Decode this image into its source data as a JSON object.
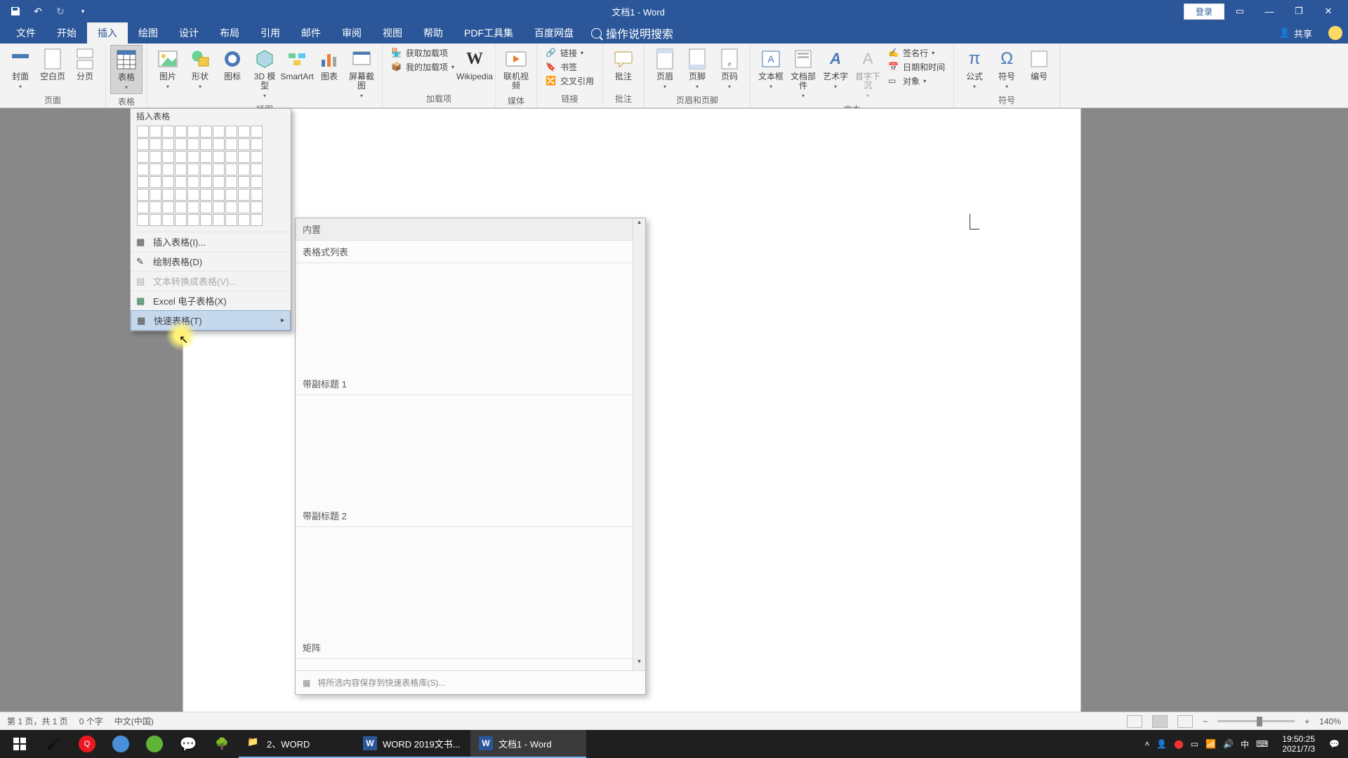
{
  "titlebar": {
    "title": "文档1 - Word",
    "login": "登录"
  },
  "tabs": {
    "file": "文件",
    "home": "开始",
    "insert": "插入",
    "draw": "绘图",
    "design": "设计",
    "layout": "布局",
    "references": "引用",
    "mailings": "邮件",
    "review": "审阅",
    "view": "视图",
    "help": "帮助",
    "pdf": "PDF工具集",
    "baidu": "百度网盘",
    "tellme": "操作说明搜索",
    "share": "共享"
  },
  "ribbon": {
    "groups": {
      "pages": "页面",
      "tables": "表格",
      "illustrations": "插图",
      "addins": "加载项",
      "media": "媒体",
      "links": "链接",
      "comments": "批注",
      "headerfooter": "页眉和页脚",
      "text": "文本",
      "symbols": "符号"
    },
    "buttons": {
      "cover": "封面",
      "blank": "空白页",
      "break": "分页",
      "table": "表格",
      "picture": "图片",
      "shapes": "形状",
      "icons": "图标",
      "model3d": "3D 模型",
      "smartart": "SmartArt",
      "chart": "图表",
      "screenshot": "屏幕截图",
      "getaddins": "获取加载项",
      "myaddins": "我的加载项",
      "wikipedia": "Wikipedia",
      "onlinevideo": "联机视频",
      "link": "链接",
      "bookmark": "书签",
      "crossref": "交叉引用",
      "comment": "批注",
      "header": "页眉",
      "footer": "页脚",
      "pagenum": "页码",
      "textbox": "文本框",
      "quickparts": "文档部件",
      "wordart": "艺术字",
      "dropcap": "首字下沉",
      "signature": "签名行",
      "datetime": "日期和时间",
      "object": "对象",
      "equation": "公式",
      "symbol": "符号",
      "number": "编号"
    }
  },
  "tableMenu": {
    "title": "插入表格",
    "insert": "插入表格(I)...",
    "draw": "绘制表格(D)",
    "convert": "文本转换成表格(V)...",
    "excel": "Excel 电子表格(X)",
    "quick": "快速表格(T)"
  },
  "quickTable": {
    "builtin": "内置",
    "styledList": "表格式列表",
    "sub1": "带副标题 1",
    "sub2": "带副标题 2",
    "matrix": "矩阵",
    "save": "将所选内容保存到快速表格库(S)..."
  },
  "statusbar": {
    "page": "第 1 页，共 1 页",
    "words": "0 个字",
    "lang": "中文(中国)",
    "zoom": "140%"
  },
  "taskbar": {
    "task1": "2、WORD",
    "task2": "WORD 2019文书...",
    "task3": "文档1 - Word",
    "ime": "中",
    "time": "19:50:25",
    "date": "2021/7/3"
  }
}
